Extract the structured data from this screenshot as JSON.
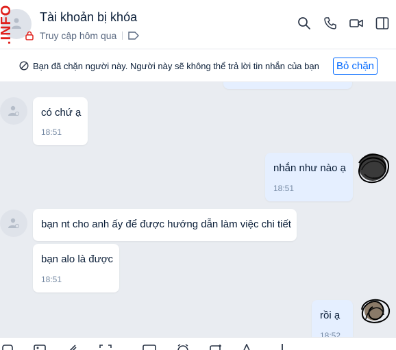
{
  "header": {
    "watermark": ".INFO",
    "title": "Tài khoản bị khóa",
    "status": "Truy cập hôm qua",
    "icons": [
      "search-icon",
      "phone-icon",
      "video-icon",
      "sidebar-toggle-icon"
    ]
  },
  "blocked_bar": {
    "text": "Bạn đã chặn người này. Người này sẽ không thể trả lời tin nhắn của bạn",
    "unblock_label": "Bỏ chặn"
  },
  "messages": [
    {
      "from": "other",
      "text": "có chứ ạ",
      "time": "18:51"
    },
    {
      "from": "me",
      "text": "nhắn như nào ạ",
      "time": "18:51"
    },
    {
      "from": "other",
      "text": "bạn nt cho anh ấy để được hướng dẫn làm việc chi tiết",
      "time": ""
    },
    {
      "from": "other",
      "text": "bạn alo là được",
      "time": "18:51"
    },
    {
      "from": "me",
      "text": "rồi ạ",
      "time": "18:52"
    }
  ],
  "toolbar": {
    "icons": [
      "sticker-icon",
      "image-icon",
      "attach-icon",
      "screenshot-icon",
      "card-icon",
      "reminder-icon",
      "task-icon",
      "text-format-icon",
      "more-icon"
    ]
  },
  "colors": {
    "accent": "#0068ff",
    "chat_background": "#e9ecf1",
    "my_bubble": "#e5efff",
    "watermark": "#e0201c"
  }
}
